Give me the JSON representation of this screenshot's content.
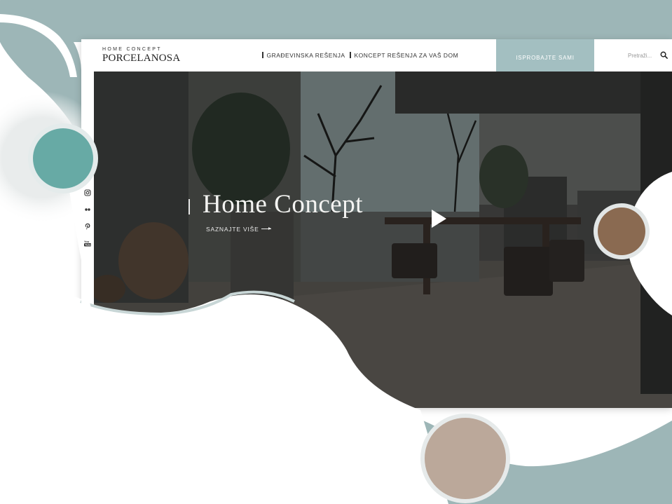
{
  "header": {
    "logo_top": "HOME CONCEPT",
    "logo_main": "PORCELANOSA",
    "nav": [
      {
        "label": "GRAĐEVINSKA REŠENJA"
      },
      {
        "label": "KONCEPT REŠENJA ZA VAŠ DOM"
      }
    ],
    "cta_label": "ISPROBAJTE SAMI",
    "search_placeholder": "Pretraži..."
  },
  "hero": {
    "title": "Home Concept",
    "link_label": "SAZNAJTE VIŠE"
  },
  "social_icons": [
    "twitter-icon",
    "instagram-icon",
    "flickr-icon",
    "pinterest-icon",
    "youtube-icon"
  ],
  "colors": {
    "backdrop_teal": "#9db6b7",
    "accent_teal": "#67aaa5",
    "brown": "#8a6a51",
    "taupe": "#bba89a",
    "cta_bg": "#a3bfc1"
  }
}
